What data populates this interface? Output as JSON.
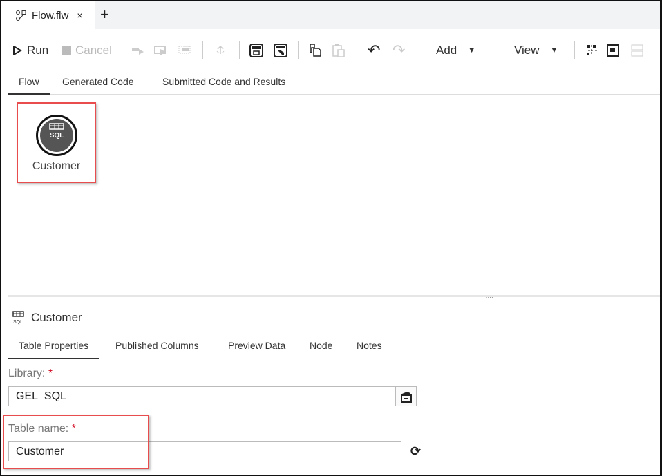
{
  "doc_tab": {
    "title": "Flow.flw",
    "close": "×",
    "new_tab": "+"
  },
  "toolbar": {
    "run": "Run",
    "cancel": "Cancel",
    "add": "Add",
    "view": "View"
  },
  "view_tabs": [
    "Flow",
    "Generated Code",
    "Submitted Code and Results"
  ],
  "canvas": {
    "node": {
      "icon_text": "SQL",
      "label": "Customer"
    }
  },
  "splitter": {
    "grip": "...."
  },
  "properties": {
    "icon_text": "SQL",
    "title": "Customer",
    "tabs": [
      "Table Properties",
      "Published Columns",
      "Preview Data",
      "Node",
      "Notes"
    ],
    "library_label": "Library:",
    "library_value": "GEL_SQL",
    "table_label": "Table name:",
    "table_value": "Customer",
    "required_mark": "*"
  }
}
